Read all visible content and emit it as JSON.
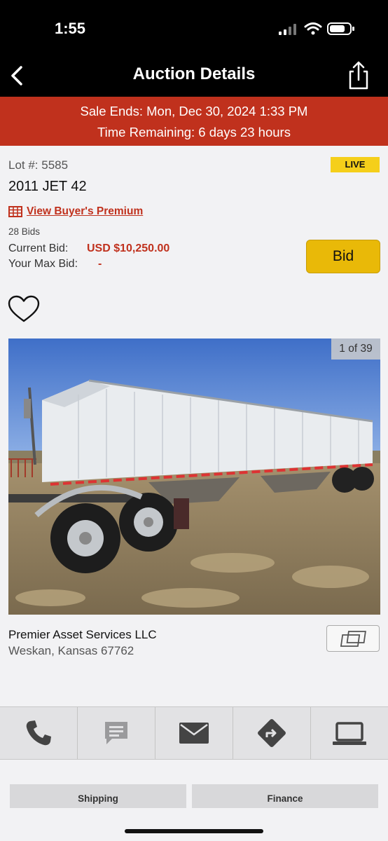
{
  "status_bar": {
    "time": "1:55"
  },
  "nav": {
    "title": "Auction Details"
  },
  "sale": {
    "ends_text": "Sale Ends: Mon, Dec 30, 2024 1:33 PM",
    "remaining_text": "Time Remaining: 6 days 23 hours"
  },
  "lot": {
    "number_text": "Lot #: 5585",
    "status_badge": "LIVE",
    "title": "2011 JET 42",
    "buyers_premium_link": "View Buyer's Premium",
    "bids_count": "28 Bids",
    "current_bid_label": "Current Bid:",
    "current_bid_value": "USD $10,250.00",
    "max_bid_label": "Your Max Bid:",
    "max_bid_value": "-",
    "bid_button": "Bid"
  },
  "photo": {
    "counter": "1 of 39",
    "subject": "white grain hopper trailer in dry field"
  },
  "seller": {
    "name": "Premier Asset Services LLC",
    "location": "Weskan, Kansas 67762"
  },
  "actions": [
    "phone-icon",
    "chat-icon",
    "mail-icon",
    "directions-icon",
    "laptop-icon"
  ],
  "tabs": {
    "shipping": "Shipping",
    "finance": "Finance"
  },
  "colors": {
    "accent_red": "#c0311d",
    "bid_yellow": "#e9b908",
    "live_yellow": "#f5cf1a",
    "header_black": "#000000"
  }
}
